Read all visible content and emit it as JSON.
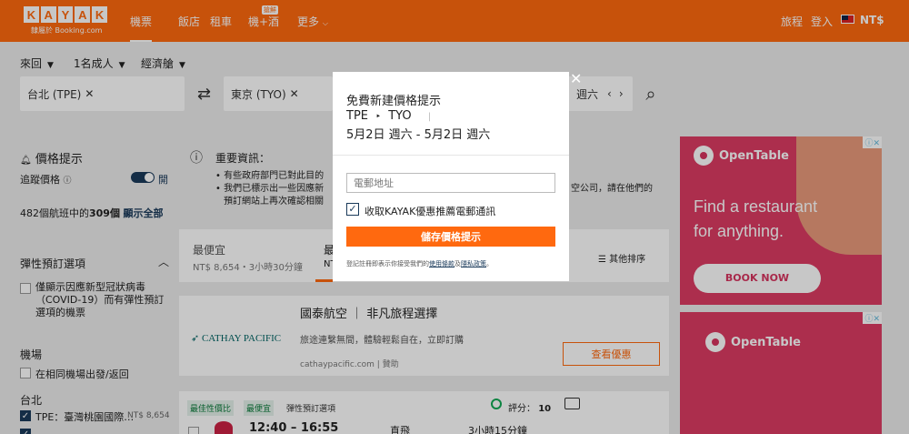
{
  "header": {
    "logo_letters": [
      "K",
      "A",
      "Y",
      "A",
      "K"
    ],
    "logo_sub": "隸屬於 Booking.com",
    "nav": [
      "機票",
      "飯店",
      "租車",
      "機+酒",
      "更多"
    ],
    "new_badge": "搶鮮",
    "trips": "旅程",
    "login": "登入",
    "currency": "NT$"
  },
  "search": {
    "options": [
      "來回",
      "1名成人",
      "經濟艙"
    ],
    "origin": "台北 (TPE)",
    "destination": "東京 (TYO)",
    "date_partial": "週六"
  },
  "sidebar": {
    "alert_title": "價格提示",
    "track_label": "追蹤價格",
    "toggle_label": "開",
    "count_prefix": "482個航班中的",
    "count_bold": "309個",
    "show_all": "顯示全部",
    "flex_title": "彈性預訂選項",
    "flex_option": "僅顯示因應新型冠狀病毒（COVID-19）而有彈性預訂選項的機票",
    "airport_title": "機場",
    "same_airport": "在相同機場出發/返回",
    "taipei": "台北",
    "tpe_label": "TPE：臺灣桃園國際…",
    "tpe_price": "NT$ 8,654"
  },
  "notice": {
    "title": "重要資訊：",
    "line1": "有些政府部門已對此目的",
    "line2": "我們已標示出一些因應新",
    "line2_end": "空公司，請在他們的",
    "line3": "預訂網站上再次確認相關"
  },
  "sort": {
    "cheapest_label": "最便宜",
    "cheapest_value": "NT$ 8,654・3小時30分鐘",
    "best_partial": "最",
    "best_value_partial": "NT",
    "other_sort": "其他排序"
  },
  "promo": {
    "airline": "CATHAY PACIFIC",
    "title": "國泰航空 ｜ 非凡旅程選擇",
    "desc": "旅途連繫無間，體驗輕鬆自在，立即訂購",
    "source": "cathaypacific.com",
    "sponsored": "贊助",
    "cta": "查看優惠"
  },
  "result": {
    "tags": [
      "最佳性價比",
      "最便宜",
      "彈性預訂選項"
    ],
    "score_label": "評分：",
    "score": "10",
    "time": "12:40 – 16:55",
    "stops": "直飛",
    "duration": "3小時15分鐘"
  },
  "ads": [
    {
      "brand": "OpenTable",
      "headline1": "Find a restaurant",
      "headline2": "for anything.",
      "button": "BOOK NOW"
    },
    {
      "brand": "OpenTable"
    }
  ],
  "modal": {
    "title": "免費新建價格提示",
    "from": "TPE",
    "arrow": "‣",
    "to": "TYO",
    "sep": "|",
    "dates": "5月2日 週六 - 5月2日 週六",
    "email_placeholder": "電郵地址",
    "opt_in": "收取KAYAK優惠推薦電郵通訊",
    "save": "儲存價格提示",
    "legal_prefix": "登記註冊即表示你接受我們的",
    "terms": "使用條款",
    "and": "及",
    "privacy": "隱私政策",
    "legal_end": "。"
  },
  "colors": {
    "brand": "#ff690f",
    "navy": "#1a3a5a",
    "ad": "#d8345f"
  }
}
